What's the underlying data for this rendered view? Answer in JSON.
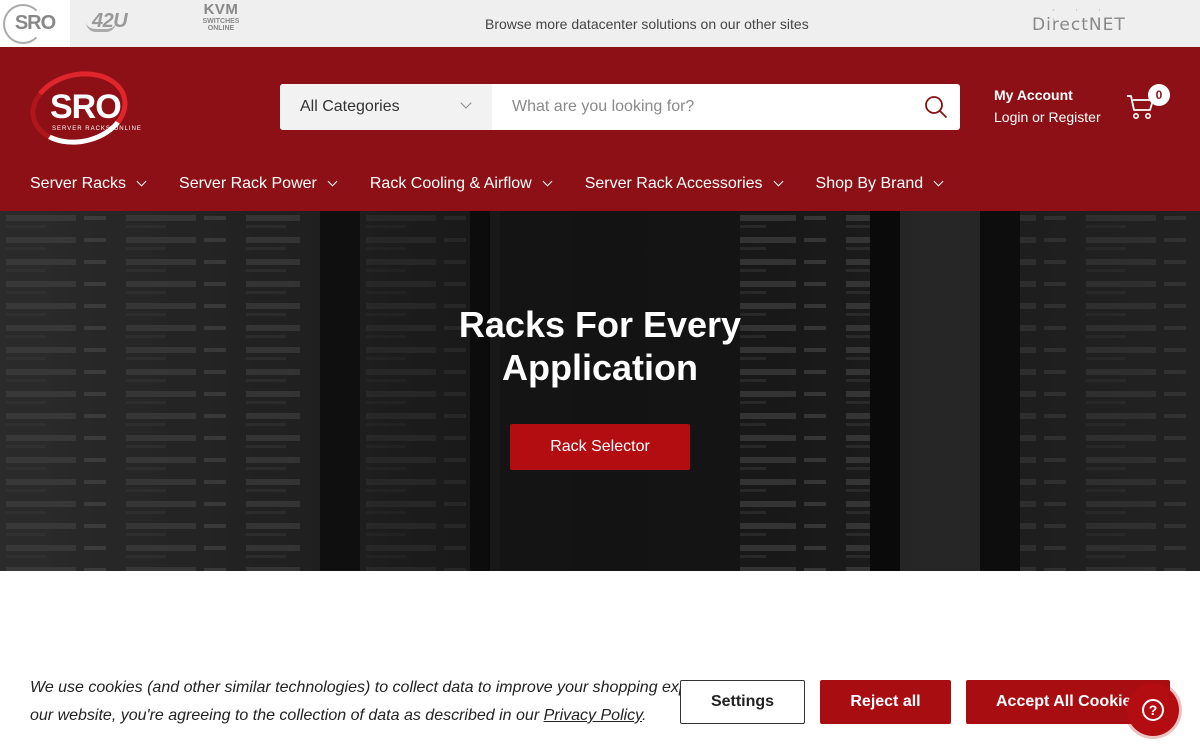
{
  "network_bar": {
    "logos": {
      "sro": "SRO",
      "u42": "42U",
      "kvm_big": "KVM",
      "kvm_small": "SWITCHES ONLINE",
      "directnet": "DirectNET"
    },
    "tagline": "Browse more datacenter solutions on our other sites"
  },
  "header": {
    "brand": {
      "name": "SRO",
      "subtitle": "SERVER RACKS ONLINE"
    },
    "search": {
      "category": "All Categories",
      "placeholder": "What are you looking for?",
      "icon": "search-icon"
    },
    "account": {
      "title": "My Account",
      "links": "Login or Register"
    },
    "cart": {
      "count": "0",
      "icon": "cart-icon"
    },
    "colors": {
      "primary": "#8c1015",
      "accent": "#b30d12"
    }
  },
  "nav": {
    "items": [
      {
        "label": "Server Racks"
      },
      {
        "label": "Server Rack Power"
      },
      {
        "label": "Rack Cooling & Airflow"
      },
      {
        "label": "Server Rack Accessories"
      },
      {
        "label": "Shop By Brand"
      }
    ]
  },
  "hero": {
    "title": "Racks For Every Application",
    "button": "Rack Selector"
  },
  "cookie": {
    "text_line1": "We use cookies (and other similar technologies) to collect data to improve your shopping experience. By using",
    "text_line2": "our website, you're agreeing to the collection of data as described in our",
    "policy_link": "Privacy Policy",
    "text_end": ".",
    "settings": "Settings",
    "reject": "Reject all",
    "accept": "Accept All Cookies",
    "help_icon": "help-icon",
    "help_glyph": "?"
  }
}
